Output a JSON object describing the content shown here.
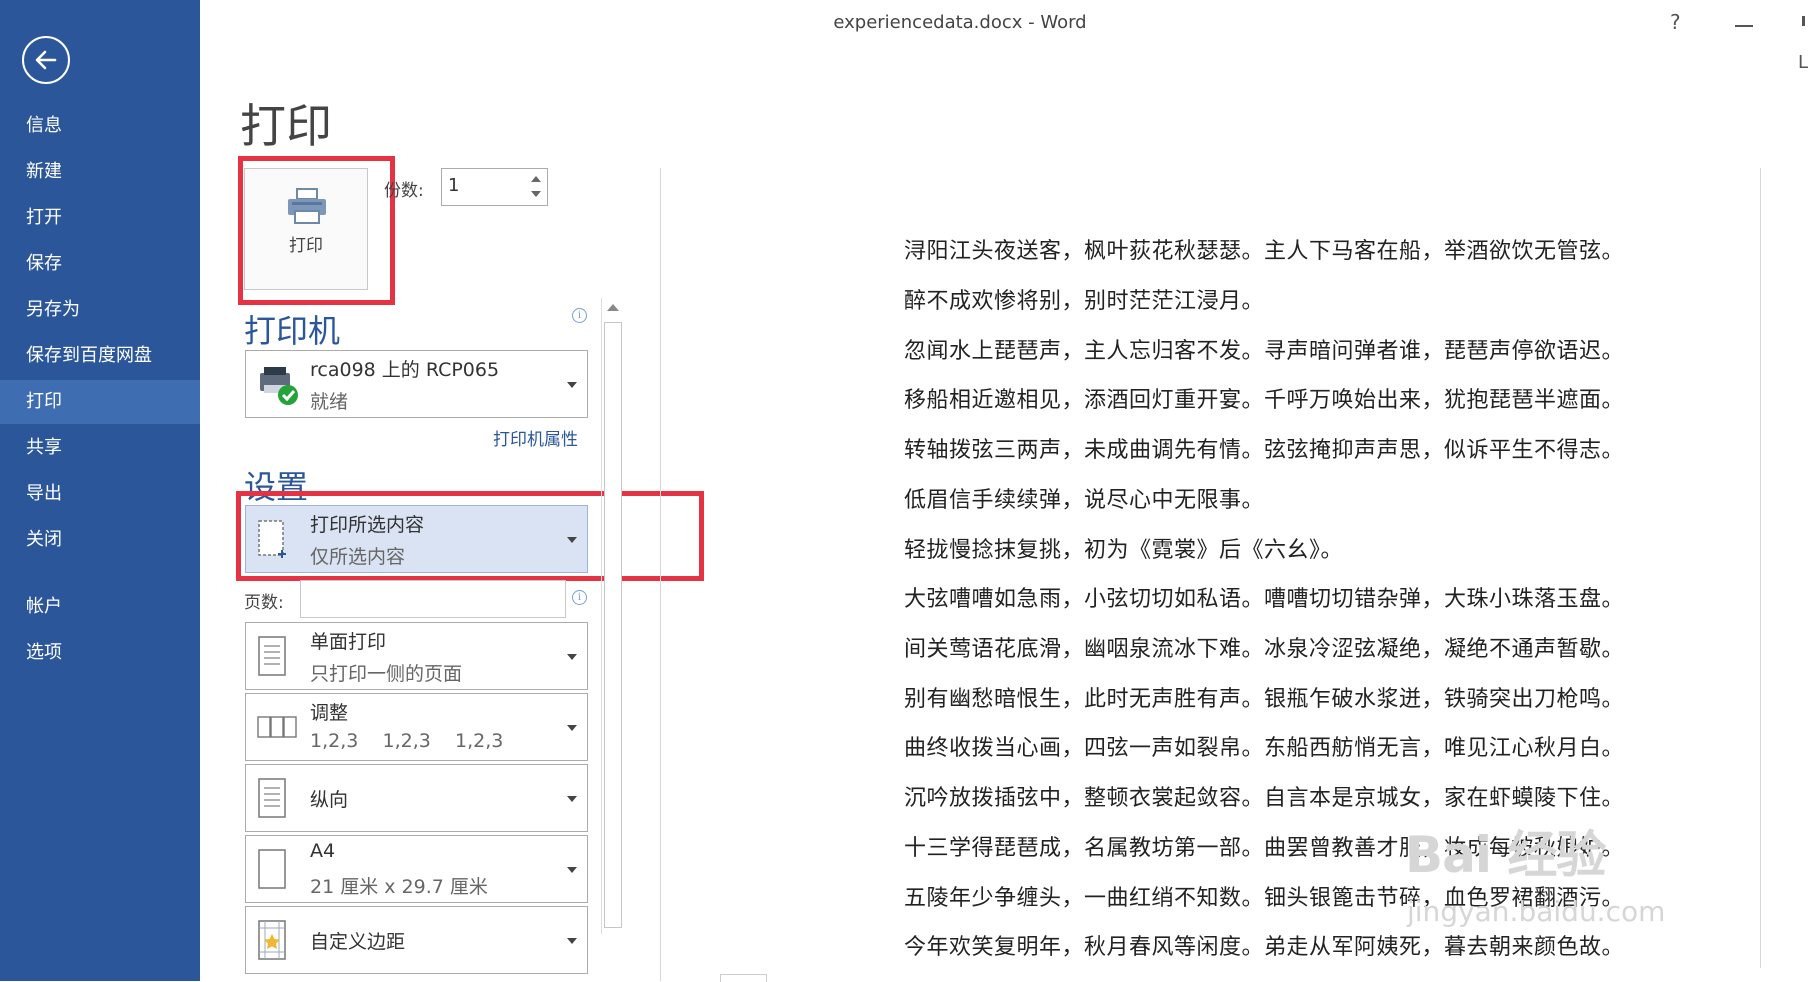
{
  "window": {
    "title": "experiencedata.docx - Word",
    "help": "?",
    "user_initial": "L"
  },
  "sidebar": {
    "items": [
      {
        "label": "信息"
      },
      {
        "label": "新建"
      },
      {
        "label": "打开"
      },
      {
        "label": "保存"
      },
      {
        "label": "另存为"
      },
      {
        "label": "保存到百度网盘"
      },
      {
        "label": "打印"
      },
      {
        "label": "共享"
      },
      {
        "label": "导出"
      },
      {
        "label": "关闭"
      },
      {
        "label": "帐户"
      },
      {
        "label": "选项"
      }
    ],
    "active": "打印"
  },
  "print": {
    "title": "打印",
    "button_label": "打印",
    "copies_label": "份数:",
    "copies_value": "1"
  },
  "printer": {
    "section_title": "打印机",
    "name": "rca098 上的 RCP065",
    "status": "就绪",
    "properties_link": "打印机属性"
  },
  "settings": {
    "section_title": "设置",
    "range": {
      "main": "打印所选内容",
      "sub": "仅所选内容"
    },
    "pages_label": "页数:",
    "pages_value": "",
    "sides": {
      "main": "单面打印",
      "sub": "只打印一侧的页面"
    },
    "collate": {
      "main": "调整",
      "sub": "1,2,3    1,2,3    1,2,3"
    },
    "orientation": {
      "main": "纵向"
    },
    "paper": {
      "main": "A4",
      "sub": "21 厘米 x 29.7 厘米"
    },
    "margins": {
      "main": "自定义边距"
    }
  },
  "document": {
    "lines": [
      "浔阳江头夜送客，枫叶荻花秋瑟瑟。主人下马客在船，举酒欲饮无管弦。",
      "醉不成欢惨将别，别时茫茫江浸月。",
      "忽闻水上琵琶声，主人忘归客不发。寻声暗问弹者谁，琵琶声停欲语迟。",
      "移船相近邀相见，添酒回灯重开宴。千呼万唤始出来，犹抱琵琶半遮面。",
      "转轴拨弦三两声，未成曲调先有情。弦弦掩抑声声思，似诉平生不得志。",
      "低眉信手续续弹，说尽心中无限事。",
      "轻拢慢捻抹复挑，初为《霓裳》后《六幺》。",
      "大弦嘈嘈如急雨，小弦切切如私语。嘈嘈切切错杂弹，大珠小珠落玉盘。",
      "间关莺语花底滑，幽咽泉流冰下难。冰泉冷涩弦凝绝，凝绝不通声暂歇。",
      "别有幽愁暗恨生，此时无声胜有声。银瓶乍破水浆迸，铁骑突出刀枪鸣。",
      "曲终收拨当心画，四弦一声如裂帛。东船西舫悄无言，唯见江心秋月白。",
      "沉吟放拨插弦中，整顿衣裳起敛容。自言本是京城女，家在虾蟆陵下住。",
      "十三学得琵琶成，名属教坊第一部。曲罢曾教善才服，妆成每被秋娘妒。",
      "五陵年少争缠头，一曲红绡不知数。钿头银篦击节碎，血色罗裙翻酒污。",
      "今年欢笑复明年，秋月春风等闲度。弟走从军阿姨死，暮去朝来颜色故。"
    ]
  },
  "watermark": {
    "brand": "Bai 经验",
    "url": "jingyan.baidu.com"
  },
  "colors": {
    "sidebar": "#2b579a",
    "accent": "#2b579a",
    "highlight_box": "#e63344",
    "selected": "#dae3f3"
  }
}
